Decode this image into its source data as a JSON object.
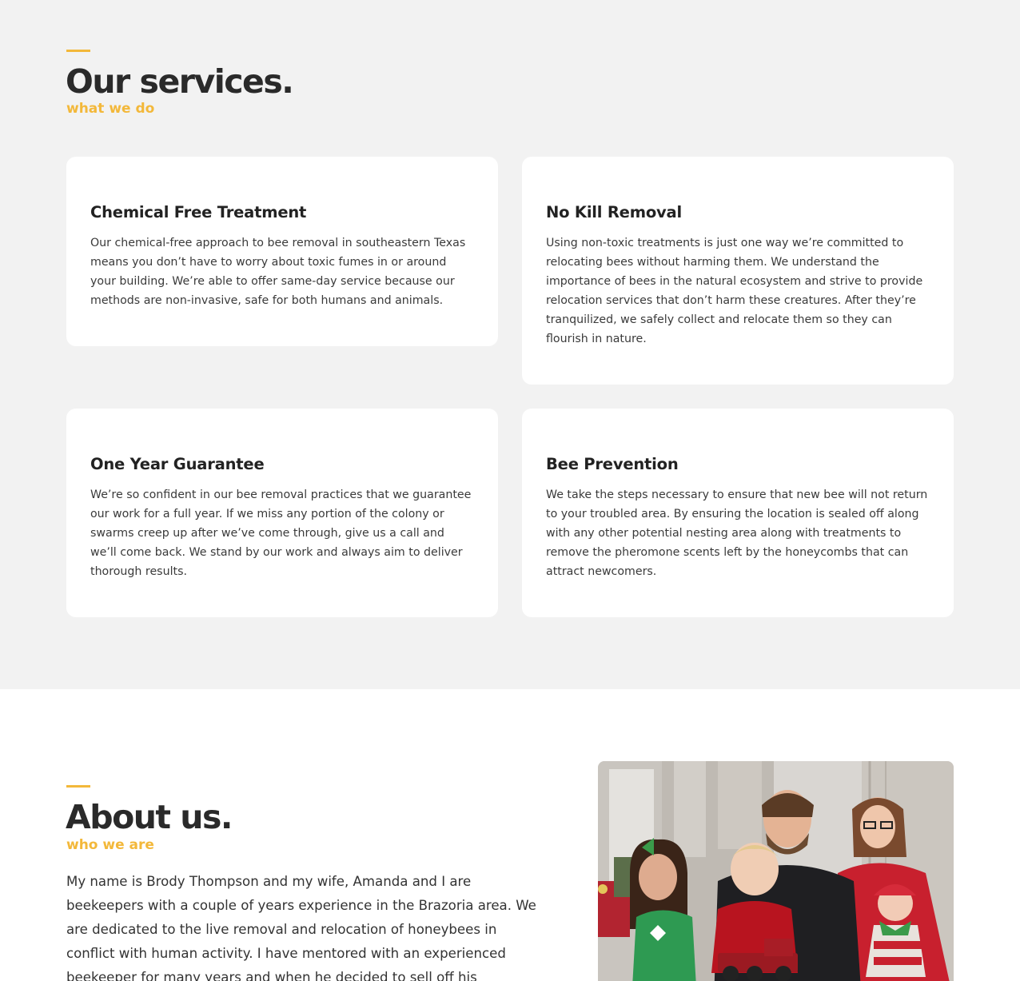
{
  "services": {
    "title": "Our services.",
    "subtitle": "what we do",
    "cards": [
      {
        "title": "Chemical Free Treatment",
        "text": "Our chemical-free approach to bee removal in southeastern Texas means you don’t have to worry about toxic fumes in or around your building. We’re able to offer same-day service because our methods are non-invasive, safe for both humans and animals."
      },
      {
        "title": "No Kill Removal",
        "text": "Using non-toxic treatments is just one way we’re committed to relocating bees without harming them. We understand the importance of bees in the natural ecosystem and strive to provide relocation services that don’t harm these creatures. After they’re tranquilized, we safely collect and relocate them so they can flourish in nature."
      },
      {
        "title": "One Year Guarantee",
        "text": "We’re so confident in our bee removal practices that we guarantee our work for a full year. If we miss any portion of the colony or swarms creep up after we’ve come through, give us a call and we’ll come back. We stand by our work and always aim to deliver thorough results."
      },
      {
        "title": "Bee Prevention",
        "text": "We take the steps necessary to ensure that new bee will not return to your troubled area. By ensuring the location is sealed off along with any other potential nesting area along with treatments to remove the pheromone scents left by the honeycombs that can attract newcomers."
      }
    ]
  },
  "about": {
    "title": "About us.",
    "subtitle": "who we are",
    "text": "My name is Brody Thompson and my wife, Amanda and I are beekeepers with a couple of years experience in the Brazoria area. We are dedicated to the live removal and relocation of honeybees in conflict with human activity. I have mentored with an experienced beekeeper for many years and when he decided to sell off his business, he gifted us some hives to"
  },
  "colors": {
    "accent": "#f3b83a",
    "services_bg": "#f2f2f2",
    "card_bg": "#ffffff",
    "heading": "#2a2a2a"
  }
}
